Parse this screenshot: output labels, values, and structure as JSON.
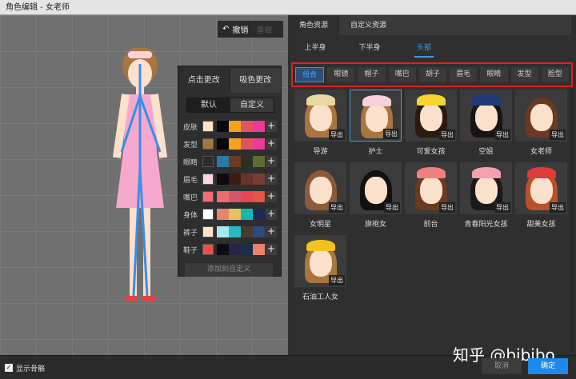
{
  "title": "角色编辑 - 女老师",
  "canvas": {
    "undo": "撤销",
    "redo": "重做"
  },
  "color_panel": {
    "tabs": [
      "点击更改",
      "吸色更改"
    ],
    "modes": [
      "默认",
      "自定义"
    ],
    "rows": [
      {
        "label": "皮肤",
        "current": "#fde2c6",
        "swatches": [
          "#0a0a0c",
          "#f7a21c",
          "#e05561",
          "#ee3a96"
        ]
      },
      {
        "label": "发型",
        "current": "#a87640",
        "swatches": [
          "#07070a",
          "#f7a21c",
          "#e05561",
          "#ee3a96"
        ]
      },
      {
        "label": "眼睛",
        "current": "#2b2b2b",
        "swatches": [
          "#2b7aa3",
          "#6b3a22",
          "#2e3122",
          "#5d6e35"
        ]
      },
      {
        "label": "眉毛",
        "current": "#fbd5e0",
        "swatches": [
          "#0f0d0c",
          "#3a1c14",
          "#6a3424",
          "#7a3c36"
        ]
      },
      {
        "label": "嘴巴",
        "current": "#f26b73",
        "swatches": [
          "#ee6a70",
          "#d3556b",
          "#eb4552",
          "#e15646"
        ]
      },
      {
        "label": "身体",
        "current": "#ffffff",
        "swatches": [
          "#e3866c",
          "#e8c25d",
          "#16b7ad",
          "#1a2a55"
        ]
      },
      {
        "label": "裤子",
        "current": "#fde2c6",
        "swatches": [
          "#a6e8f2",
          "#2ab9c0",
          "#4a3a34",
          "#2e4a7e"
        ]
      },
      {
        "label": "鞋子",
        "current": "#ef5040",
        "swatches": [
          "#0c0c12",
          "#262640",
          "#1a2e4a",
          "#e6836c"
        ]
      }
    ],
    "plus": "+",
    "add_custom": "添加到自定义"
  },
  "right": {
    "tabs": [
      "角色资源",
      "自定义资源"
    ],
    "subtabs": [
      "上半身",
      "下半身",
      "头部"
    ],
    "categories": [
      "组合",
      "眼镜",
      "帽子",
      "嘴巴",
      "胡子",
      "眉毛",
      "眼睛",
      "发型",
      "脸型"
    ],
    "export": "导出",
    "items": [
      {
        "name": "导游",
        "hair": "#a8763e",
        "hat": "#e8d9a0"
      },
      {
        "name": "护士",
        "hair": "#a8763e",
        "hat": "#f8d0dc"
      },
      {
        "name": "可爱女孩",
        "hair": "#2a1a12",
        "hat": "#f4d62a"
      },
      {
        "name": "空姐",
        "hair": "#1a1412",
        "hat": "#1e3a7a"
      },
      {
        "name": "女老师",
        "hair": "#6b3a22",
        "hat": ""
      },
      {
        "name": "女明星",
        "hair": "#8a5a3a",
        "hat": ""
      },
      {
        "name": "旗袍女",
        "hair": "#111111",
        "hat": ""
      },
      {
        "name": "前台",
        "hair": "#6b3a22",
        "hat": "#f08080"
      },
      {
        "name": "青春阳光女孩",
        "hair": "#1a1a1a",
        "hat": "#f4a0b0"
      },
      {
        "name": "甜美女孩",
        "hair": "#b8502a",
        "hat": "#e23a3a"
      },
      {
        "name": "石油工人女",
        "hair": "#a8763e",
        "hat": "#f4c21c"
      }
    ]
  },
  "bottom": {
    "show_bones": "显示骨骼",
    "check": "✓",
    "cancel": "取消",
    "ok": "确定",
    "watermark": "知乎 @bibibo"
  }
}
